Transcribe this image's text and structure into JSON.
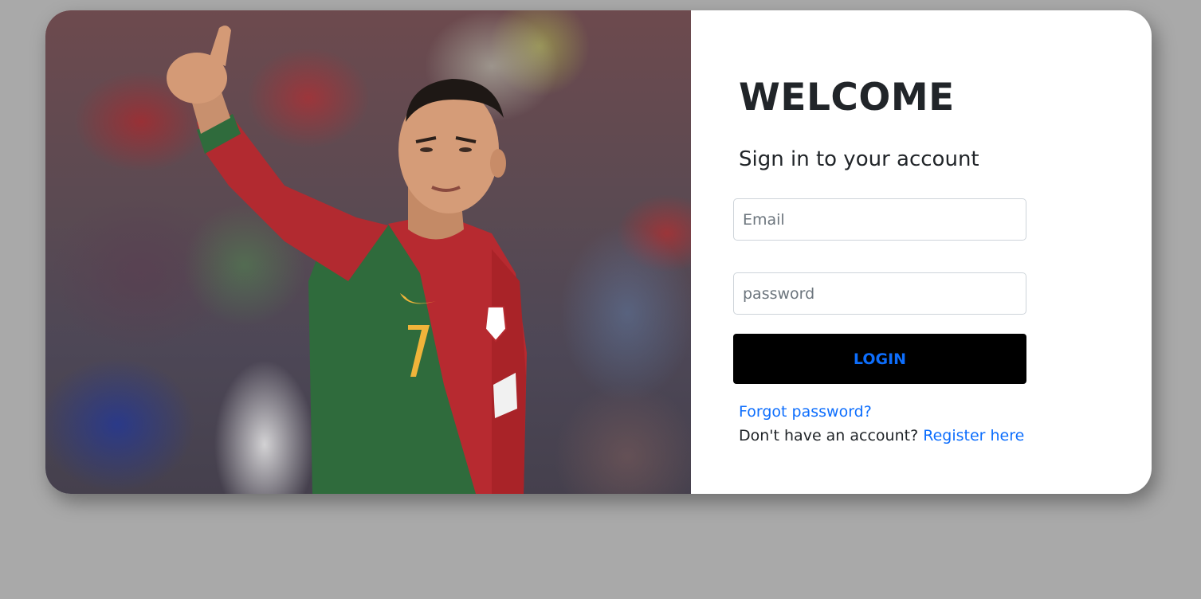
{
  "photo": {
    "alt": "Portugal football player giving a thumbs up",
    "jersey_number": "7"
  },
  "form": {
    "title": "WELCOME",
    "subtitle": "Sign in to your account",
    "email_placeholder": "Email",
    "password_placeholder": "password",
    "login_label": "LOGIN",
    "forgot_label": "Forgot password?",
    "no_account_text": "Don't have an account?",
    "register_label": "Register here"
  },
  "colors": {
    "page_background": "#a9a9a9",
    "card_background": "#ffffff",
    "button_background": "#000000",
    "link_color": "#0d6efd",
    "jersey_red": "#b72a30",
    "jersey_green": "#2f6b3c"
  }
}
